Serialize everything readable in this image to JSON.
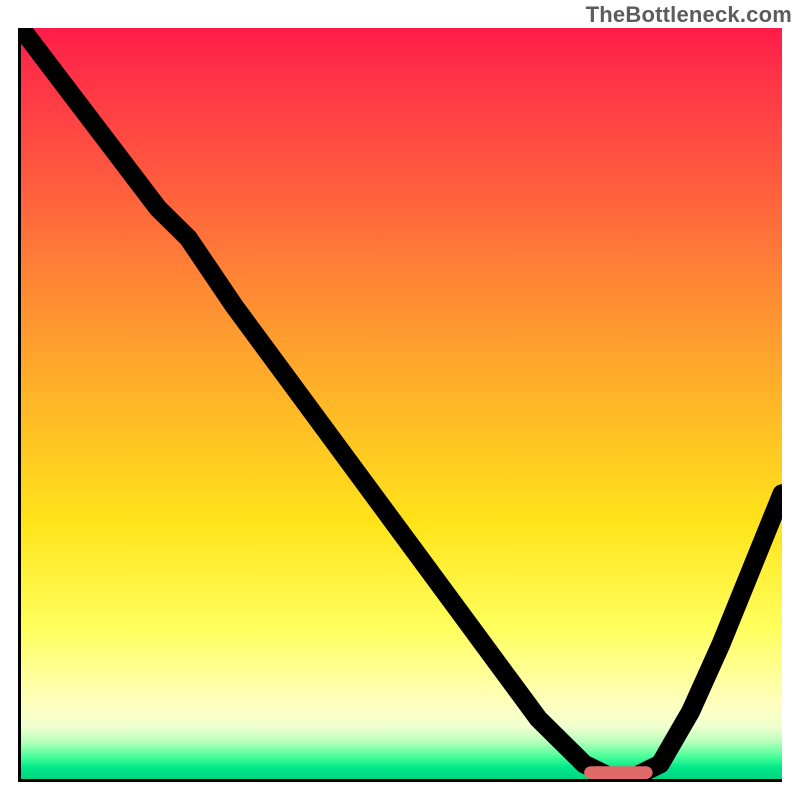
{
  "watermark": "TheBottleneck.com",
  "chart_data": {
    "type": "line",
    "title": "",
    "xlabel": "",
    "ylabel": "",
    "xlim": [
      0,
      100
    ],
    "ylim": [
      0,
      100
    ],
    "grid": false,
    "legend": false,
    "series": [
      {
        "name": "bottleneck-curve",
        "x": [
          0,
          6,
          12,
          18,
          22,
          28,
          36,
          44,
          52,
          60,
          68,
          74,
          78,
          80,
          84,
          88,
          92,
          96,
          100
        ],
        "y": [
          100,
          92,
          84,
          76,
          72,
          63,
          52,
          41,
          30,
          19,
          8,
          2,
          0,
          0,
          2,
          9,
          18,
          28,
          38
        ]
      }
    ],
    "annotations": [
      {
        "name": "optimal-marker",
        "x_start": 74,
        "x_end": 83,
        "y": 0
      }
    ],
    "background_gradient": {
      "orientation": "vertical",
      "stops": [
        {
          "pos": 0.0,
          "color": "#ff1b49"
        },
        {
          "pos": 0.2,
          "color": "#ff5a3f"
        },
        {
          "pos": 0.5,
          "color": "#ffb727"
        },
        {
          "pos": 0.8,
          "color": "#ffff5e"
        },
        {
          "pos": 0.93,
          "color": "#f1ffd0"
        },
        {
          "pos": 1.0,
          "color": "#00d480"
        }
      ]
    }
  }
}
